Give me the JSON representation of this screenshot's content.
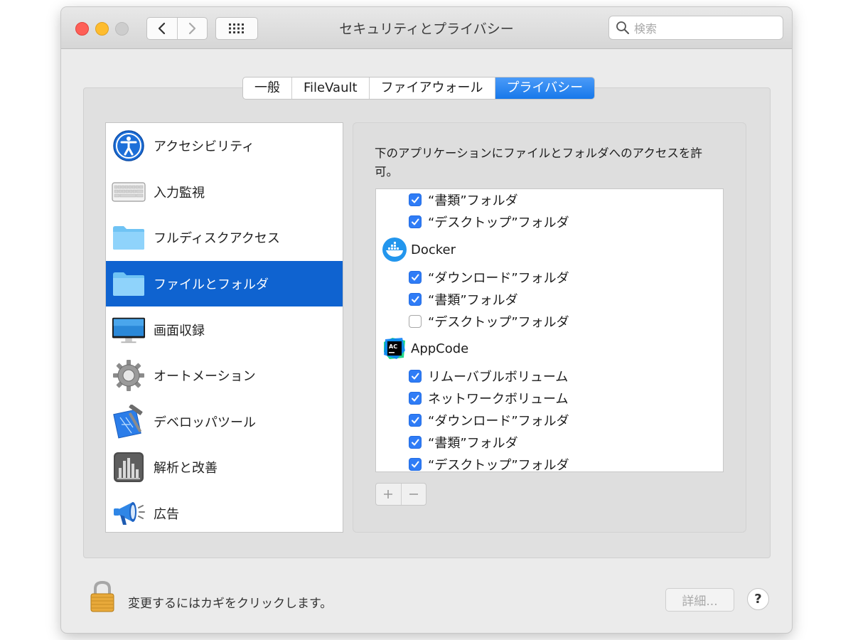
{
  "window": {
    "title": "セキュリティとプライバシー"
  },
  "toolbar": {
    "search_placeholder": "検索"
  },
  "tabs": [
    {
      "label": "一般",
      "active": false
    },
    {
      "label": "FileVault",
      "active": false
    },
    {
      "label": "ファイアウォール",
      "active": false
    },
    {
      "label": "プライバシー",
      "active": true
    }
  ],
  "sidebar": {
    "items": [
      {
        "label": "アクセシビリティ",
        "icon": "accessibility-icon"
      },
      {
        "label": "入力監視",
        "icon": "keyboard-icon"
      },
      {
        "label": "フルディスクアクセス",
        "icon": "folder-icon"
      },
      {
        "label": "ファイルとフォルダ",
        "icon": "folder-icon",
        "selected": true
      },
      {
        "label": "画面収録",
        "icon": "display-icon"
      },
      {
        "label": "オートメーション",
        "icon": "gear-icon"
      },
      {
        "label": "デベロッパツール",
        "icon": "xcode-icon"
      },
      {
        "label": "解析と改善",
        "icon": "analytics-icon"
      },
      {
        "label": "広告",
        "icon": "megaphone-icon"
      }
    ]
  },
  "detail": {
    "description": "下のアプリケーションにファイルとフォルダへのアクセスを許可。",
    "list": [
      {
        "label": "“書類”フォルダ",
        "checked": true
      },
      {
        "label": "“デスクトップ”フォルダ",
        "checked": true
      },
      {
        "app": "Docker",
        "icon": "docker-icon"
      },
      {
        "label": "“ダウンロード”フォルダ",
        "checked": true
      },
      {
        "label": "“書類”フォルダ",
        "checked": true
      },
      {
        "label": "“デスクトップ”フォルダ",
        "checked": false
      },
      {
        "app": "AppCode",
        "icon": "appcode-icon"
      },
      {
        "label": "リムーバブルボリューム",
        "checked": true
      },
      {
        "label": "ネットワークボリューム",
        "checked": true
      },
      {
        "label": "“ダウンロード”フォルダ",
        "checked": true
      },
      {
        "label": "“書類”フォルダ",
        "checked": true
      },
      {
        "label": "“デスクトップ”フォルダ",
        "checked": true
      }
    ],
    "add_symbol": "+",
    "remove_symbol": "−"
  },
  "footer": {
    "lock_text": "変更するにはカギをクリックします。",
    "advanced_label": "詳細...",
    "help_label": "?"
  },
  "colors": {
    "accent": "#0f63d0",
    "checkbox": "#2f7cf6",
    "close": "#fe5f57",
    "minimize": "#febc2e"
  }
}
